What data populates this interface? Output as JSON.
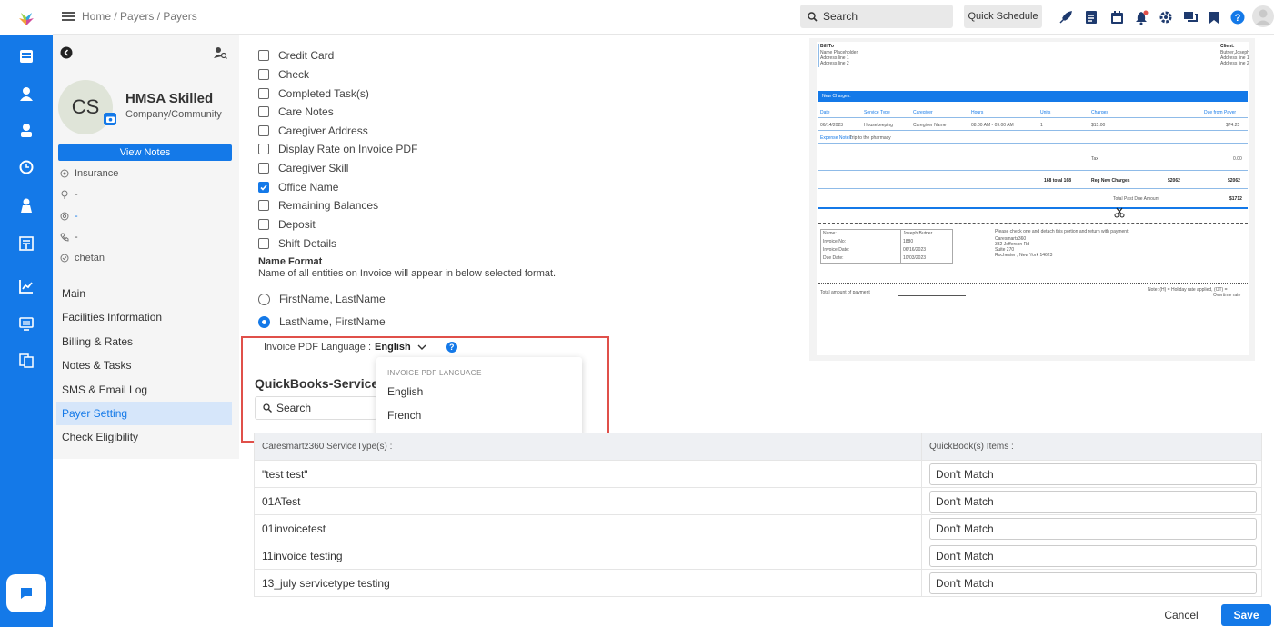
{
  "topbar": {
    "breadcrumb": "Home / Payers / Payers",
    "search_label": "Search",
    "quick_schedule": "Quick Schedule"
  },
  "payer": {
    "initials": "CS",
    "name": "HMSA Skilled",
    "type": "Company/Community",
    "view_notes": "View Notes",
    "insurance": "Insurance",
    "location": "-",
    "email": "-",
    "phone": "-",
    "contact": "chetan"
  },
  "menu": [
    "Main",
    "Facilities Information",
    "Billing & Rates",
    "Notes & Tasks",
    "SMS & Email Log",
    "Payer Setting",
    "Check Eligibility"
  ],
  "checkboxes": [
    {
      "label": "Credit Card",
      "checked": false
    },
    {
      "label": "Check",
      "checked": false
    },
    {
      "label": "Completed Task(s)",
      "checked": false
    },
    {
      "label": "Care Notes",
      "checked": false
    },
    {
      "label": "Caregiver Address",
      "checked": false
    },
    {
      "label": "Display Rate on Invoice PDF",
      "checked": false
    },
    {
      "label": "Caregiver Skill",
      "checked": false
    },
    {
      "label": "Office Name",
      "checked": true
    },
    {
      "label": "Remaining Balances",
      "checked": false
    },
    {
      "label": "Deposit",
      "checked": false
    },
    {
      "label": "Shift Details",
      "checked": false
    }
  ],
  "name_format": {
    "title": "Name Format",
    "desc": "Name of all entities on Invoice will appear in below selected format.",
    "opt1": "FirstName, LastName",
    "opt2": "LastName, FirstName"
  },
  "language": {
    "label": "Invoice PDF Language :",
    "value": "English",
    "dropdown_header": "INVOICE PDF LANGUAGE",
    "options": [
      "English",
      "French"
    ]
  },
  "quickbooks": {
    "title": "QuickBooks-Service",
    "search": "Search",
    "col1": "Caresmartz360 ServiceType(s) :",
    "col2": "QuickBook(s) Items :",
    "rows": [
      {
        "service": "\"test test\"",
        "item": "Don't Match"
      },
      {
        "service": "01ATest",
        "item": "Don't Match"
      },
      {
        "service": "01invoicetest",
        "item": "Don't Match"
      },
      {
        "service": "11invoice testing",
        "item": "Don't Match"
      },
      {
        "service": "13_july servicetype testing",
        "item": "Don't Match"
      }
    ]
  },
  "footer": {
    "cancel": "Cancel",
    "save": "Save"
  },
  "invoice": {
    "bill_to": "Bill To",
    "name_placeholder": "Name Placeholder",
    "addr1": "Address line 1",
    "addr2": "Address line 2",
    "client": "Client:",
    "client_name": "Butner,Joseph",
    "new_charges": "New Charges:",
    "headers": [
      "Date",
      "Service Type",
      "Caregiver",
      "Hours",
      "Units",
      "Charges",
      "Due from Payer"
    ],
    "row": [
      "06/14/2023",
      "Housekeeping",
      "Caregiver Name",
      "08:00 AM - 09:00 AM",
      "1",
      "$15.00",
      "$74.25"
    ],
    "expense_label": "Expense Notes:",
    "expense_text": "Trip to the pharmacy",
    "tax": "Tax",
    "tax_val": "0.00",
    "total_label": "168 total 168",
    "reg_new": "Reg New Charges",
    "reg_val1": "$2062",
    "reg_val2": "$2062",
    "past_due": "Total Past Due Amount",
    "past_due_val": "$1712",
    "stub_labels": [
      "Name:",
      "Invoice No:",
      "Invoice Date:",
      "Due Date:"
    ],
    "stub_vals": [
      "Joseph,Butner",
      "1880",
      "06/16/2023",
      "10/03/2023"
    ],
    "stub_msg": "Please check one and detach this portion and return with payment.",
    "stub_addr": [
      "Caresmartz360",
      "332 Jefferson Rd",
      "Suite 270",
      "Rochester , New York 14623"
    ],
    "total_payment": "Total amount of payment",
    "note": "Note: (H) = Holiday rate applied, (OT) =",
    "note2": "Overtime rate"
  },
  "colors": {
    "accent": "#1479e8",
    "highlight": "#e0504a"
  }
}
